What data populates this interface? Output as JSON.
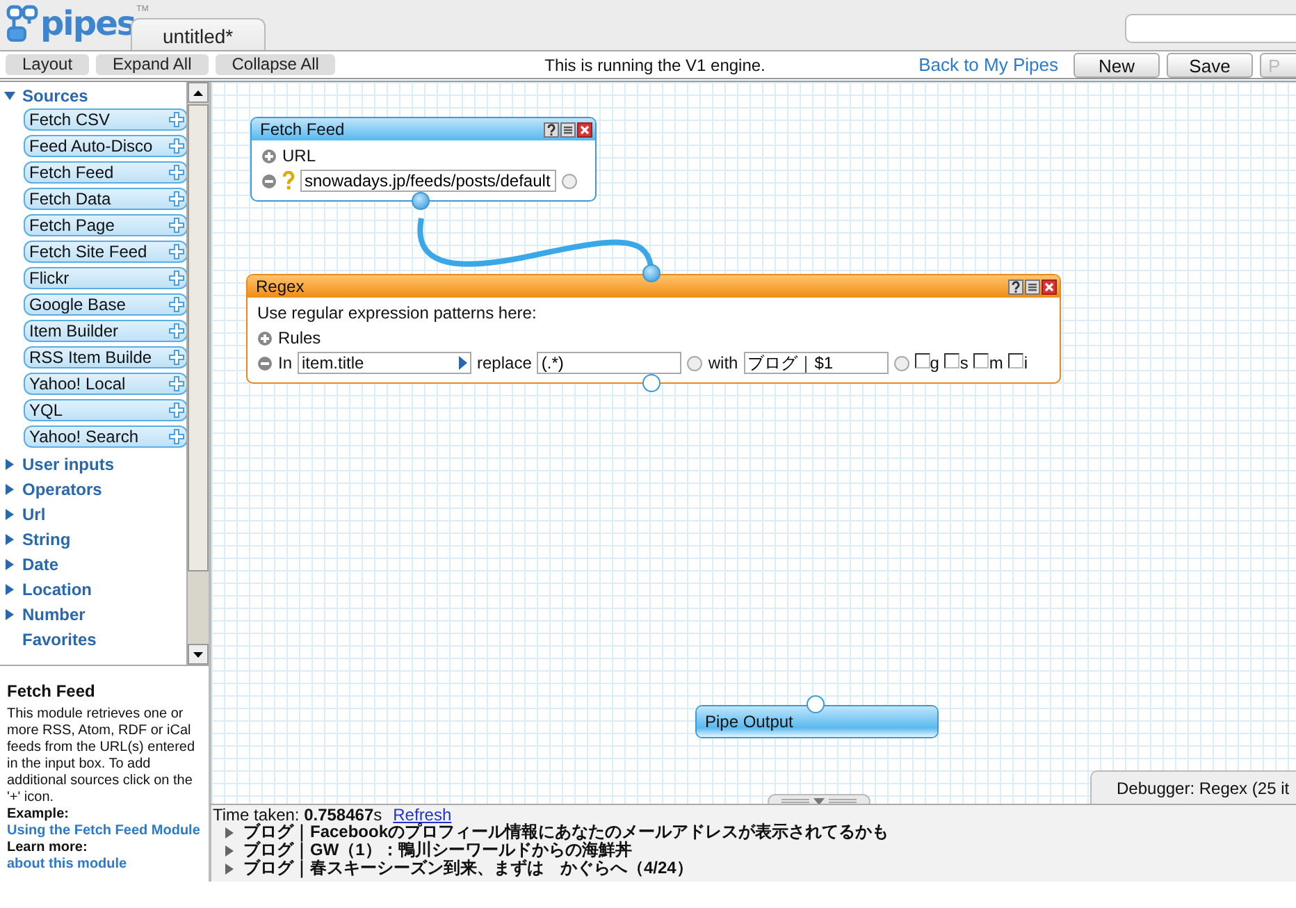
{
  "logo": {
    "text": "pipes",
    "mark": "TM"
  },
  "tabs": [
    {
      "label": "untitled*",
      "selected": true
    }
  ],
  "toolbar": {
    "buttons": [
      "Layout",
      "Expand All",
      "Collapse All"
    ],
    "notice": "This is running the V1 engine.",
    "link": "Back to My Pipes",
    "actions": [
      {
        "label": "New",
        "disabled": false
      },
      {
        "label": "Save",
        "disabled": false
      },
      {
        "label": "P",
        "disabled": true
      }
    ]
  },
  "sidebar": {
    "categories": [
      {
        "label": "Sources",
        "kind": "group",
        "expanded": true,
        "items": [
          "Fetch CSV",
          "Feed Auto-Disco",
          "Fetch Feed",
          "Fetch Data",
          "Fetch Page",
          "Fetch Site Feed",
          "Flickr",
          "Google Base",
          "Item Builder",
          "RSS Item Builde",
          "Yahoo! Local",
          "YQL",
          "Yahoo! Search"
        ]
      },
      {
        "label": "User inputs",
        "kind": "group",
        "expanded": false
      },
      {
        "label": "Operators",
        "kind": "group",
        "expanded": false
      },
      {
        "label": "Url",
        "kind": "group",
        "expanded": false
      },
      {
        "label": "String",
        "kind": "group",
        "expanded": false
      },
      {
        "label": "Date",
        "kind": "group",
        "expanded": false
      },
      {
        "label": "Location",
        "kind": "group",
        "expanded": false
      },
      {
        "label": "Number",
        "kind": "group",
        "expanded": false
      },
      {
        "label": "Favorites",
        "kind": "plain"
      }
    ]
  },
  "help": {
    "title": "Fetch Feed",
    "text": "This module retrieves one or more RSS, Atom, RDF or iCal feeds from the URL(s) entered in the input box. To add additional sources click on the '+' icon.",
    "example_label": "Example:",
    "example_link": "Using the Fetch Feed Module",
    "more_label": "Learn more:",
    "more_link": "about this module"
  },
  "canvas": {
    "modules": [
      {
        "kind": "fetch",
        "title": "Fetch Feed",
        "field_label": "URL",
        "value": "snowadays.jp/feeds/posts/default"
      },
      {
        "kind": "regex",
        "title": "Regex",
        "description": "Use regular expression patterns here:",
        "rules_label": "Rules",
        "in_label": "In",
        "in_value": "item.title",
        "replace_label": "replace",
        "replace_value": "(.*)",
        "with_label": "with",
        "with_value": "ブログ｜$1",
        "flags": [
          {
            "label": "g",
            "checked": false
          },
          {
            "label": "s",
            "checked": false
          },
          {
            "label": "m",
            "checked": false
          },
          {
            "label": "i",
            "checked": false
          }
        ]
      },
      {
        "kind": "output",
        "title": "Pipe Output"
      }
    ],
    "debugger_tab": "Debugger: Regex (25 it"
  },
  "debug": {
    "time": "Time taken: **0.758467**s",
    "refresh": "Refresh",
    "results": [
      {
        "text": "ブログ｜Facebookのプロフィール情報にあなたのメールアドレスが表示されてるかも",
        "expanded": false
      },
      {
        "text": "ブログ｜GW（1）：鴨川シーワールドからの海鮮丼",
        "expanded": false
      },
      {
        "text": "ブログ｜春スキーシーズン到来、まずは　かぐらへ（4/24）",
        "expanded": false
      }
    ]
  }
}
